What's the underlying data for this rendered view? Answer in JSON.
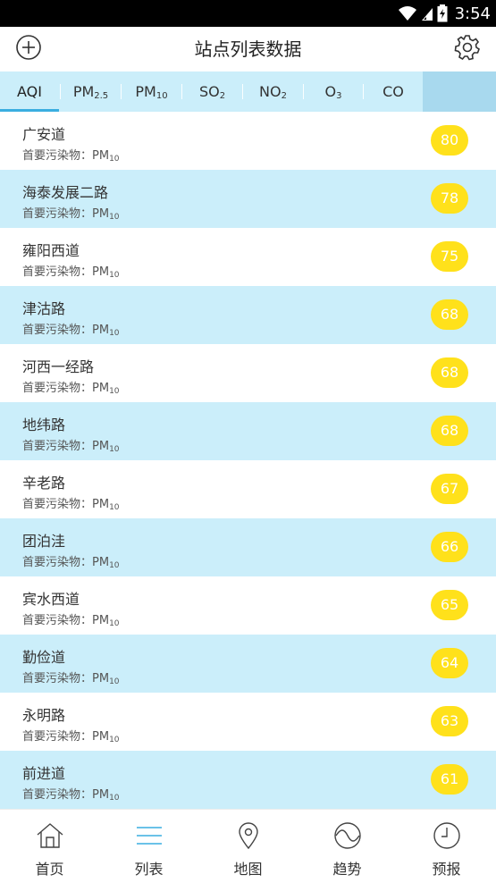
{
  "status_bar": {
    "time": "3:54"
  },
  "header": {
    "title": "站点列表数据",
    "add_icon": "plus-circle-icon",
    "settings_icon": "gear-icon"
  },
  "tabs": [
    {
      "main": "AQI",
      "sub": ""
    },
    {
      "main": "PM",
      "sub": "2.5"
    },
    {
      "main": "PM",
      "sub": "10"
    },
    {
      "main": "SO",
      "sub": "2"
    },
    {
      "main": "NO",
      "sub": "2"
    },
    {
      "main": "O",
      "sub": "3"
    },
    {
      "main": "CO",
      "sub": ""
    }
  ],
  "active_tab": "AQI",
  "stations": [
    {
      "name": "广安道",
      "pollutant_label": "首要污染物：PM",
      "pollutant_sub": "10",
      "aqi": "80"
    },
    {
      "name": "海泰发展二路",
      "pollutant_label": "首要污染物：PM",
      "pollutant_sub": "10",
      "aqi": "78"
    },
    {
      "name": "雍阳西道",
      "pollutant_label": "首要污染物：PM",
      "pollutant_sub": "10",
      "aqi": "75"
    },
    {
      "name": "津沽路",
      "pollutant_label": "首要污染物：PM",
      "pollutant_sub": "10",
      "aqi": "68"
    },
    {
      "name": "河西一经路",
      "pollutant_label": "首要污染物：PM",
      "pollutant_sub": "10",
      "aqi": "68"
    },
    {
      "name": "地纬路",
      "pollutant_label": "首要污染物：PM",
      "pollutant_sub": "10",
      "aqi": "68"
    },
    {
      "name": "辛老路",
      "pollutant_label": "首要污染物：PM",
      "pollutant_sub": "10",
      "aqi": "67"
    },
    {
      "name": "团泊洼",
      "pollutant_label": "首要污染物：PM",
      "pollutant_sub": "10",
      "aqi": "66"
    },
    {
      "name": "宾水西道",
      "pollutant_label": "首要污染物：PM",
      "pollutant_sub": "10",
      "aqi": "65"
    },
    {
      "name": "勤俭道",
      "pollutant_label": "首要污染物：PM",
      "pollutant_sub": "10",
      "aqi": "64"
    },
    {
      "name": "永明路",
      "pollutant_label": "首要污染物：PM",
      "pollutant_sub": "10",
      "aqi": "63"
    },
    {
      "name": "前进道",
      "pollutant_label": "首要污染物：PM",
      "pollutant_sub": "10",
      "aqi": "61"
    }
  ],
  "colors": {
    "row_alt": "#cbeefa",
    "badge": "#ffe11b",
    "tab_bar": "#cbeefa",
    "tab_indicator": "#3aaee0"
  },
  "bottom_nav": [
    {
      "label": "首页",
      "icon": "home-icon"
    },
    {
      "label": "列表",
      "icon": "list-icon"
    },
    {
      "label": "地图",
      "icon": "map-pin-icon"
    },
    {
      "label": "趋势",
      "icon": "trend-icon"
    },
    {
      "label": "预报",
      "icon": "clock-icon"
    }
  ],
  "active_nav": "列表"
}
